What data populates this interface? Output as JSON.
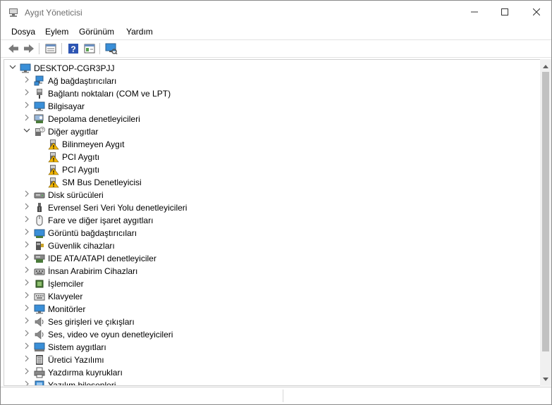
{
  "window": {
    "title": "Aygıt Yöneticisi"
  },
  "menu": [
    "Dosya",
    "Eylem",
    "Görünüm",
    "Yardım"
  ],
  "toolbar": {
    "back_icon": "back-arrow-icon",
    "forward_icon": "forward-arrow-icon",
    "properties_icon": "properties-icon",
    "help_icon": "help-icon",
    "update_icon": "update-driver-icon",
    "scan_icon": "scan-hardware-icon"
  },
  "tree": {
    "root": "DESKTOP-CGR3PJJ",
    "items": [
      {
        "label": "Ağ bağdaştırıcıları",
        "icon": "network-adapter-icon",
        "expanded": false
      },
      {
        "label": "Bağlantı noktaları (COM ve LPT)",
        "icon": "port-icon",
        "expanded": false
      },
      {
        "label": "Bilgisayar",
        "icon": "computer-icon",
        "expanded": false
      },
      {
        "label": "Depolama denetleyicileri",
        "icon": "storage-controller-icon",
        "expanded": false
      },
      {
        "label": "Diğer aygıtlar",
        "icon": "unknown-device-icon",
        "expanded": true,
        "children": [
          {
            "label": "Bilinmeyen Aygıt",
            "icon": "warning-device-icon"
          },
          {
            "label": "PCI Aygıtı",
            "icon": "warning-device-icon"
          },
          {
            "label": "PCI Aygıtı",
            "icon": "warning-device-icon"
          },
          {
            "label": "SM Bus Denetleyicisi",
            "icon": "warning-device-icon"
          }
        ]
      },
      {
        "label": "Disk sürücüleri",
        "icon": "disk-drive-icon",
        "expanded": false
      },
      {
        "label": "Evrensel Seri Veri Yolu denetleyicileri",
        "icon": "usb-icon",
        "expanded": false
      },
      {
        "label": "Fare ve diğer işaret aygıtları",
        "icon": "mouse-icon",
        "expanded": false
      },
      {
        "label": "Görüntü bağdaştırıcıları",
        "icon": "display-adapter-icon",
        "expanded": false
      },
      {
        "label": "Güvenlik cihazları",
        "icon": "security-device-icon",
        "expanded": false
      },
      {
        "label": "IDE ATA/ATAPI denetleyiciler",
        "icon": "ide-controller-icon",
        "expanded": false
      },
      {
        "label": "İnsan Arabirim Cihazları",
        "icon": "hid-icon",
        "expanded": false
      },
      {
        "label": "İşlemciler",
        "icon": "processor-icon",
        "expanded": false
      },
      {
        "label": "Klavyeler",
        "icon": "keyboard-icon",
        "expanded": false
      },
      {
        "label": "Monitörler",
        "icon": "monitor-icon",
        "expanded": false
      },
      {
        "label": "Ses girişleri ve çıkışları",
        "icon": "speaker-icon",
        "expanded": false
      },
      {
        "label": "Ses, video ve oyun denetleyicileri",
        "icon": "sound-icon",
        "expanded": false
      },
      {
        "label": "Sistem aygıtları",
        "icon": "system-device-icon",
        "expanded": false
      },
      {
        "label": "Üretici Yazılımı",
        "icon": "firmware-icon",
        "expanded": false
      },
      {
        "label": "Yazdırma kuyrukları",
        "icon": "printer-icon",
        "expanded": false
      },
      {
        "label": "Yazılım bileşenleri",
        "icon": "software-component-icon",
        "expanded": false
      }
    ]
  },
  "colors": {
    "warning": "#f2b600",
    "monitor_blue": "#3a8fd8",
    "title_gray": "#6d6d6d"
  }
}
